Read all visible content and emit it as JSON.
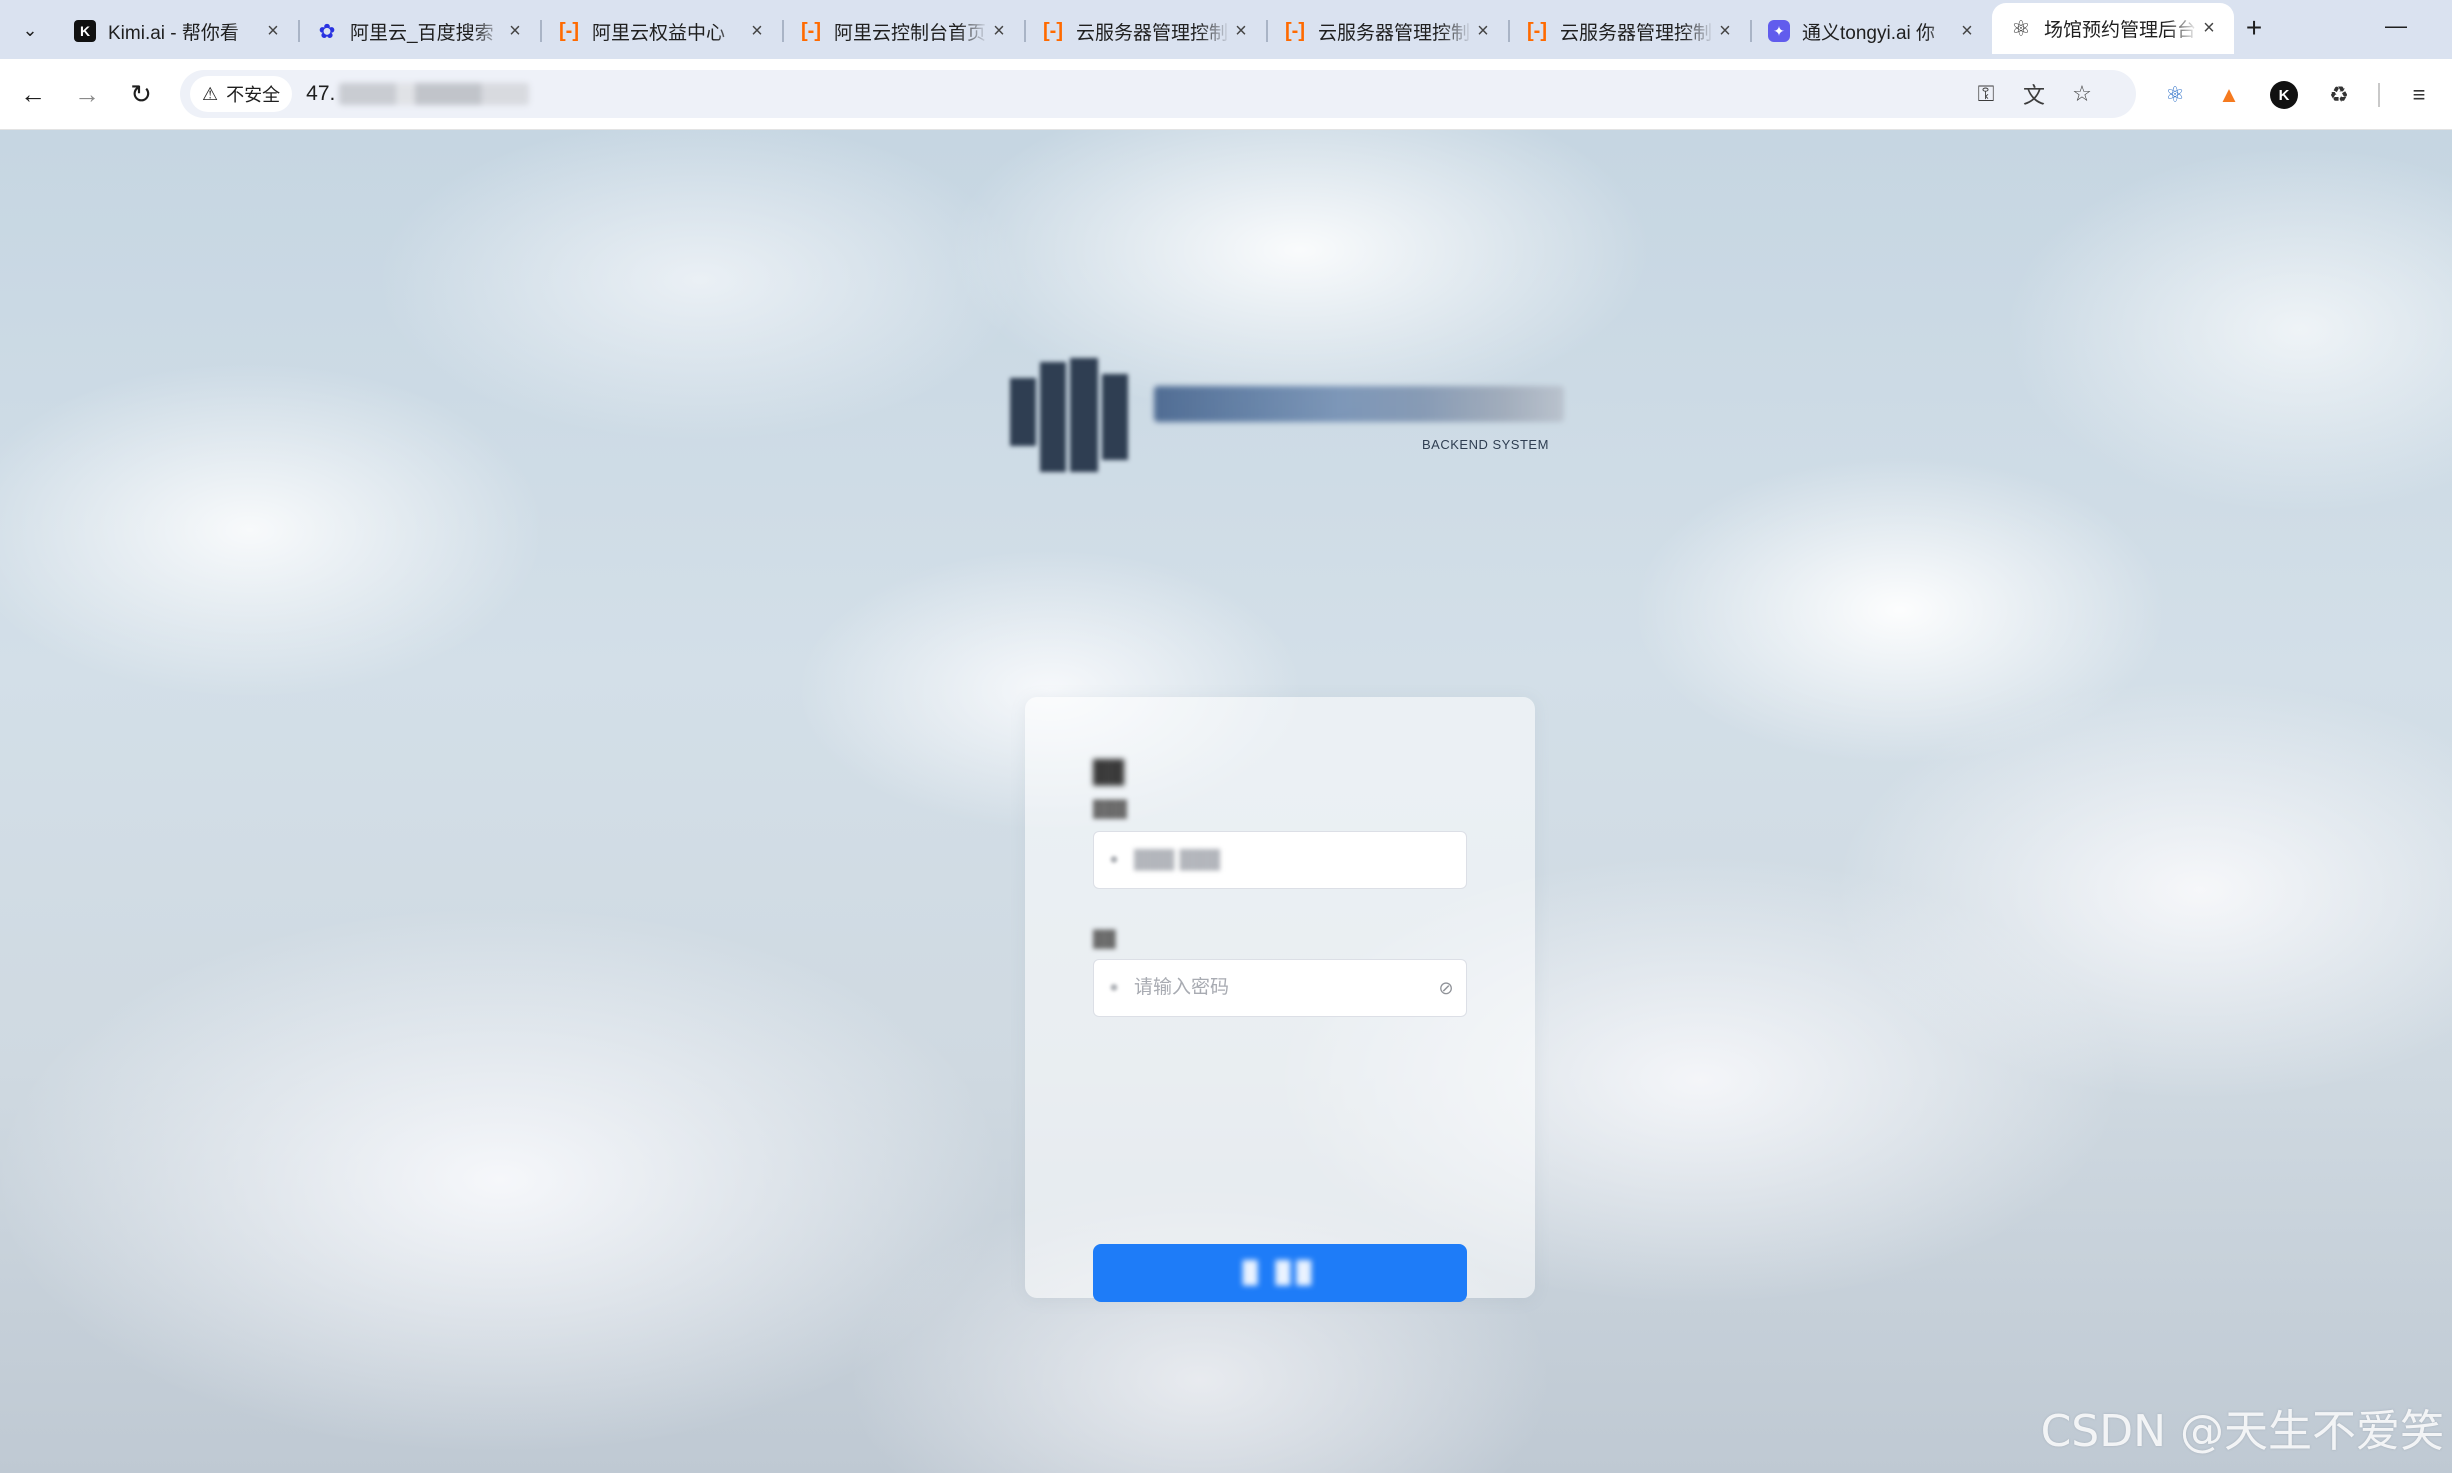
{
  "browser": {
    "tabs": [
      {
        "title": "Kimi.ai - 帮你看",
        "icon": "kimi-icon",
        "active": false
      },
      {
        "title": "阿里云_百度搜索",
        "icon": "baidu-paw-icon",
        "active": false
      },
      {
        "title": "阿里云权益中心",
        "icon": "aliyun-icon",
        "active": false
      },
      {
        "title": "阿里云控制台首页",
        "icon": "aliyun-icon",
        "active": false
      },
      {
        "title": "云服务器管理控制",
        "icon": "aliyun-icon",
        "active": false
      },
      {
        "title": "云服务器管理控制",
        "icon": "aliyun-icon",
        "active": false
      },
      {
        "title": "云服务器管理控制",
        "icon": "aliyun-icon",
        "active": false
      },
      {
        "title": "通义tongyi.ai 你",
        "icon": "tongyi-icon",
        "active": false
      },
      {
        "title": "场馆预约管理后台",
        "icon": "react-icon",
        "active": true
      }
    ],
    "security_label": "不安全",
    "url_visible": "47.",
    "extensions": [
      "react-devtools-icon",
      "metamask-fox-icon",
      "k-extension-icon",
      "extensions-puzzle-icon",
      "reading-list-icon"
    ]
  },
  "page": {
    "logo_subtitle": "BACKEND SYSTEM",
    "login": {
      "password_placeholder": "请输入密码"
    }
  },
  "watermark": "CSDN @天生不爱笑",
  "colors": {
    "primary_button": "#1e7cf8",
    "active_tab": "#ffffff",
    "tabstrip": "#dae2f0"
  }
}
